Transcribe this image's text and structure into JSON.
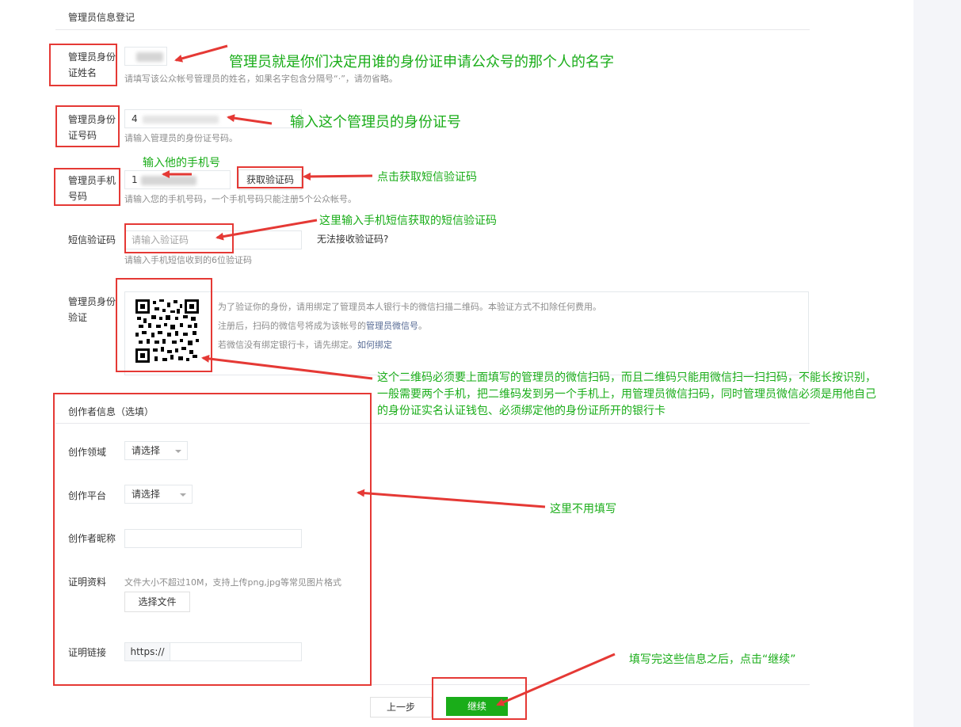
{
  "section1": {
    "title": "管理员信息登记"
  },
  "name_field": {
    "label_line1": "管理员身份",
    "label_line2": "证姓名",
    "hint": "请填写该公众帐号管理员的姓名，如果名字包含分隔号“·”，请勿省略。"
  },
  "id_field": {
    "label_line1": "管理员身份",
    "label_line2": "证号码",
    "value_prefix": "4",
    "hint": "请输入管理员的身份证号码。"
  },
  "phone_field": {
    "label_line1": "管理员手机",
    "label_line2": "号码",
    "value_prefix": "1",
    "get_code_button": "获取验证码",
    "hint": "请输入您的手机号码，一个手机号码只能注册5个公众帐号。"
  },
  "sms_field": {
    "label": "短信验证码",
    "placeholder": "请输入验证码",
    "cant_receive_link": "无法接收验证码?",
    "hint": "请输入手机短信收到的6位验证码"
  },
  "verify_field": {
    "label_line1": "管理员身份",
    "label_line2": "验证",
    "desc1": "为了验证你的身份，请用绑定了管理员本人银行卡的微信扫描二维码。本验证方式不扣除任何费用。",
    "desc2_prefix": "注册后，扫码的微信号将成为该帐号的",
    "desc2_link": "管理员微信号",
    "desc2_suffix": "。",
    "desc3_prefix": "若微信没有绑定银行卡，请先绑定。",
    "desc3_link": "如何绑定"
  },
  "section2": {
    "title": "创作者信息（选填）"
  },
  "creator": {
    "domain_label": "创作领域",
    "domain_select": "请选择",
    "platform_label": "创作平台",
    "platform_select": "请选择",
    "nickname_label": "创作者昵称",
    "proof_label": "证明资料",
    "proof_hint": "文件大小不超过10M，支持上传png,jpg等常见图片格式",
    "choose_file_button": "选择文件",
    "link_label": "证明链接",
    "link_prefix": "https://"
  },
  "footer": {
    "prev_button": "上一步",
    "continue_button": "继续"
  },
  "annotations": {
    "name": "管理员就是你们决定用谁的身份证申请公众号的那个人的名字",
    "id": "输入这个管理员的身份证号",
    "phone": "输入他的手机号",
    "get_code": "点击获取短信验证码",
    "sms": "这里输入手机短信获取的短信验证码",
    "qr_line1": "这个二维码必须要上面填写的管理员的微信扫码，而且二维码只能用微信扫一扫扫码，不能长按识别，",
    "qr_line2": "一般需要两个手机，把二维码发到另一个手机上，用管理员微信扫码，同时管理员微信必须是用他自己",
    "qr_line3": "的身份证实名认证钱包、必须绑定他的身份证所开的银行卡",
    "optional": "这里不用填写",
    "continue": "填写完这些信息之后，点击“继续”"
  },
  "colors": {
    "annotation_green": "#1aad19",
    "annotation_red": "#e53935",
    "primary": "#1aad19",
    "link": "#576b95"
  }
}
